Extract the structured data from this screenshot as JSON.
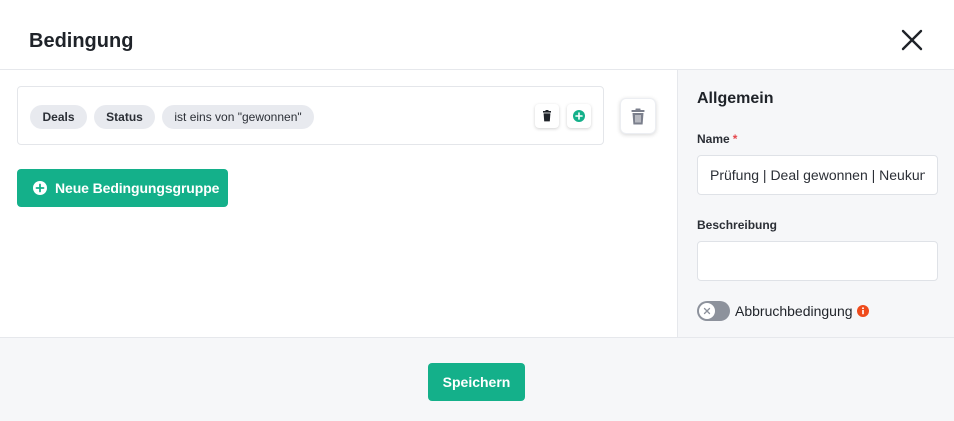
{
  "dialog": {
    "title": "Bedingung",
    "close_icon": "close-icon"
  },
  "condition_group": {
    "chips": {
      "object": "Deals",
      "field": "Status",
      "operator_value": "ist eins von \"gewonnen\""
    },
    "delete_condition_icon": "trash-icon",
    "add_condition_icon": "plus-circle-icon",
    "delete_group_icon": "trash-icon"
  },
  "buttons": {
    "new_group_label": "Neue Bedingungsgruppe",
    "save_label": "Speichern"
  },
  "general": {
    "section_title": "Allgemein",
    "name_label": "Name",
    "name_required_marker": "*",
    "name_value": "Prüfung | Deal gewonnen | Neukunde",
    "description_label": "Beschreibung",
    "description_value": "",
    "abort_toggle_label": "Abbruchbedingung",
    "abort_toggle_on": false
  },
  "colors": {
    "accent": "#14b08a",
    "required": "#e5484d",
    "info": "#ef4b1c",
    "toggle_off": "#8d929c"
  }
}
